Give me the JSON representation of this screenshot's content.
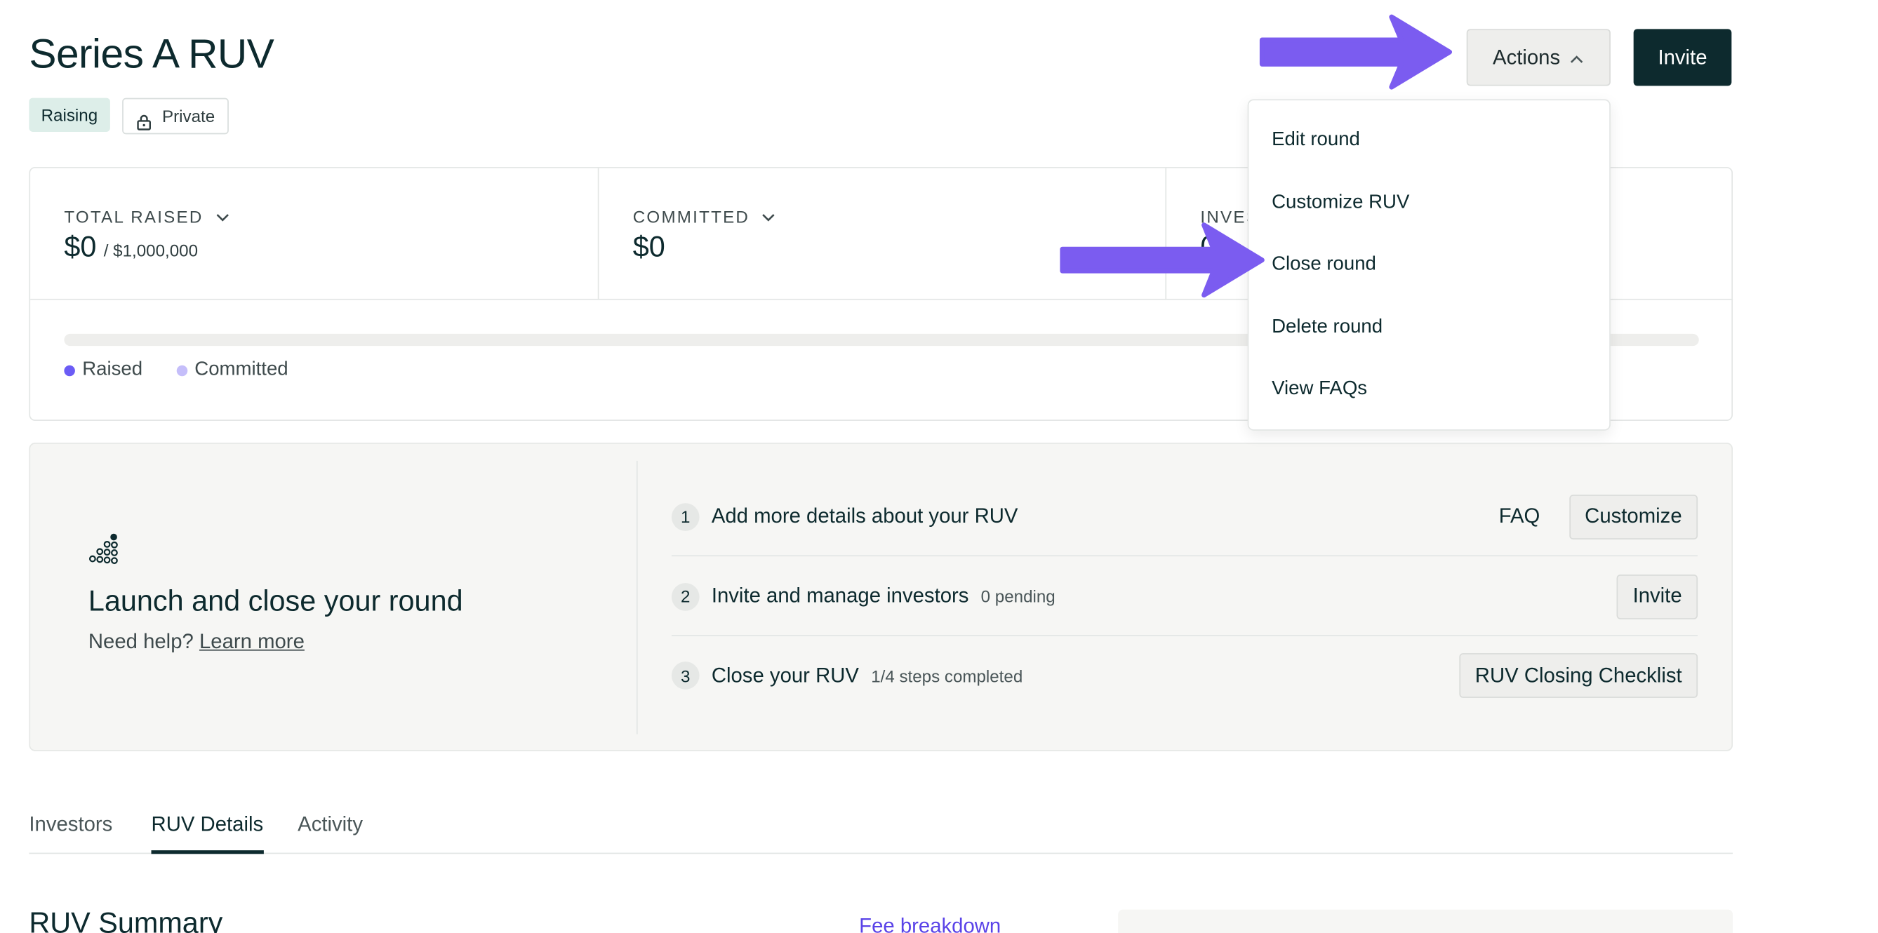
{
  "header": {
    "title": "Series A RUV",
    "status_badge": "Raising",
    "visibility_badge": "Private",
    "actions_label": "Actions",
    "invite_label": "Invite"
  },
  "stats": {
    "total_raised": {
      "label": "TOTAL RAISED",
      "value": "$0",
      "target": "/ $1,000,000"
    },
    "committed": {
      "label": "COMMITTED",
      "value": "$0"
    },
    "investors": {
      "label": "INVES",
      "value": "0"
    },
    "progress_raised_fraction": 0,
    "legend": [
      {
        "label": "Raised",
        "color": "#6b5cf5"
      },
      {
        "label": "Committed",
        "color": "#c5befa"
      }
    ]
  },
  "launch": {
    "title": "Launch and close your round",
    "help_text": "Need help?",
    "help_link": "Learn more",
    "steps": [
      {
        "num": "1",
        "title": "Add more details about your RUV",
        "meta": "",
        "link": "FAQ",
        "button": "Customize"
      },
      {
        "num": "2",
        "title": "Invite and manage investors",
        "meta": "0 pending",
        "button": "Invite"
      },
      {
        "num": "3",
        "title": "Close your RUV",
        "meta": "1/4 steps completed",
        "button": "RUV Closing Checklist"
      }
    ]
  },
  "tabs": [
    {
      "label": "Investors"
    },
    {
      "label": "RUV Details",
      "active": true
    },
    {
      "label": "Activity"
    }
  ],
  "summary": {
    "title": "RUV Summary",
    "fee_link": "Fee breakdown"
  },
  "dropdown": {
    "items": [
      {
        "label": "Edit round"
      },
      {
        "label": "Customize RUV"
      },
      {
        "label": "Close round"
      },
      {
        "label": "Delete round"
      },
      {
        "label": "View FAQs"
      }
    ]
  },
  "colors": {
    "brand_dark": "#0d2a2e",
    "accent_purple": "#6b5cf5",
    "annotation_arrow": "#7b5cf0"
  }
}
